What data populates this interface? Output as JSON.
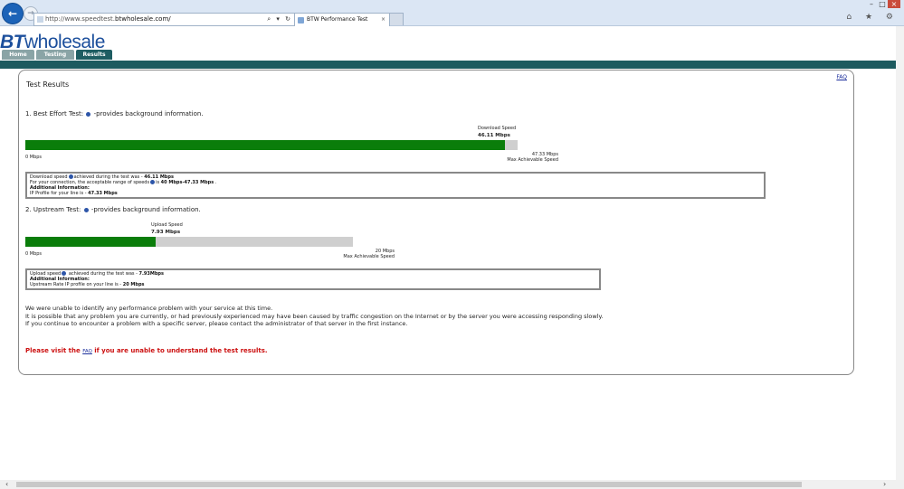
{
  "browser": {
    "url_prefix": "http://www.speedtest.",
    "url_domain": "btwholesale.com/",
    "address_tools": "⌕ ▾ ↻",
    "tab_title": "BTW Performance Test",
    "tab_close": "×",
    "window_controls": [
      "–",
      "□",
      "×"
    ],
    "chrome_icons": "⌂ ★ ⚙"
  },
  "site": {
    "logo_bt": "BT",
    "logo_rest": "wholesale",
    "tabs": [
      "Home",
      "Testing",
      "Results"
    ],
    "active_tab": "Results"
  },
  "results": {
    "title": "Test Results",
    "faq": "FAQ",
    "download": {
      "heading_prefix": "1. Best Effort Test:",
      "heading_suffix": "-provides background information.",
      "caption_label": "Download Speed",
      "caption_value": "46.11 Mbps",
      "bar_fraction": 0.9742,
      "min_label": "0 Mbps",
      "max_value": "47.33 Mbps",
      "max_label": "Max Achievable Speed",
      "info": {
        "line1_prefix": "Download speed",
        "line1_middle": "achieved during the test was -",
        "line1_value": "46.11 Mbps",
        "line2_prefix": "For your connection, the acceptable range of speeds",
        "line2_middle": "is",
        "line2_value": "40 Mbps-47.33 Mbps",
        "line2_suffix": ".",
        "line3": "Additional Information:",
        "line4_prefix": "IP Profile for your line is -",
        "line4_value": "47.33 Mbps"
      }
    },
    "upload": {
      "heading_prefix": "2. Upstream Test:",
      "heading_suffix": "-provides background information.",
      "caption_label": "Upload Speed",
      "caption_value": "7.93 Mbps",
      "bar_fraction": 0.3965,
      "min_label": "0 Mbps",
      "max_value": "20 Mbps",
      "max_label": "Max Achievable Speed",
      "info": {
        "line1_prefix": "Upload speed",
        "line1_middle": "achieved during the test was -",
        "line1_value": "7.93Mbps",
        "line2": "Additional Information:",
        "line3_prefix": "Upstream Rate IP profile on your line is -",
        "line3_value": "20 Mbps"
      }
    },
    "message_lines": [
      "We were unable to identify any performance problem with your service at this time.",
      "It is possible that any problem you are currently, or had previously experienced may have been caused by traffic congestion on the Internet or by the server you were accessing responding slowly.",
      "If you continue to encounter a problem with a specific server, please contact the administrator of that server in the first instance."
    ],
    "visit_prefix": "Please visit the",
    "visit_link": "FAQ",
    "visit_suffix": "if you are unable to understand the test results."
  },
  "scrollbar": {
    "left_arrow": "‹",
    "right_arrow": "›"
  }
}
